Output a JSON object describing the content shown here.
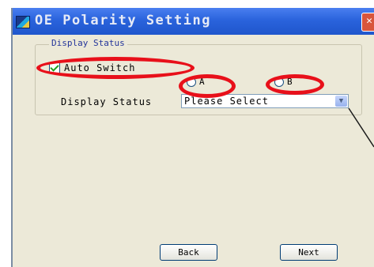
{
  "window": {
    "title": "OE Polarity Setting",
    "close_symbol": "✕"
  },
  "group": {
    "legend": "Display Status"
  },
  "auto_switch": {
    "label": "Auto Switch",
    "checked": true
  },
  "radios": [
    {
      "label": "A",
      "selected": false
    },
    {
      "label": "B",
      "selected": false
    }
  ],
  "display_status": {
    "label": "Display Status",
    "value": "Please Select",
    "arrow": "⌵"
  },
  "buttons": {
    "back": "Back",
    "next": "Next"
  },
  "colors": {
    "titlebar": "#2a63dc",
    "dialog_bg": "#ece9d8",
    "annotation": "#e8101a"
  }
}
